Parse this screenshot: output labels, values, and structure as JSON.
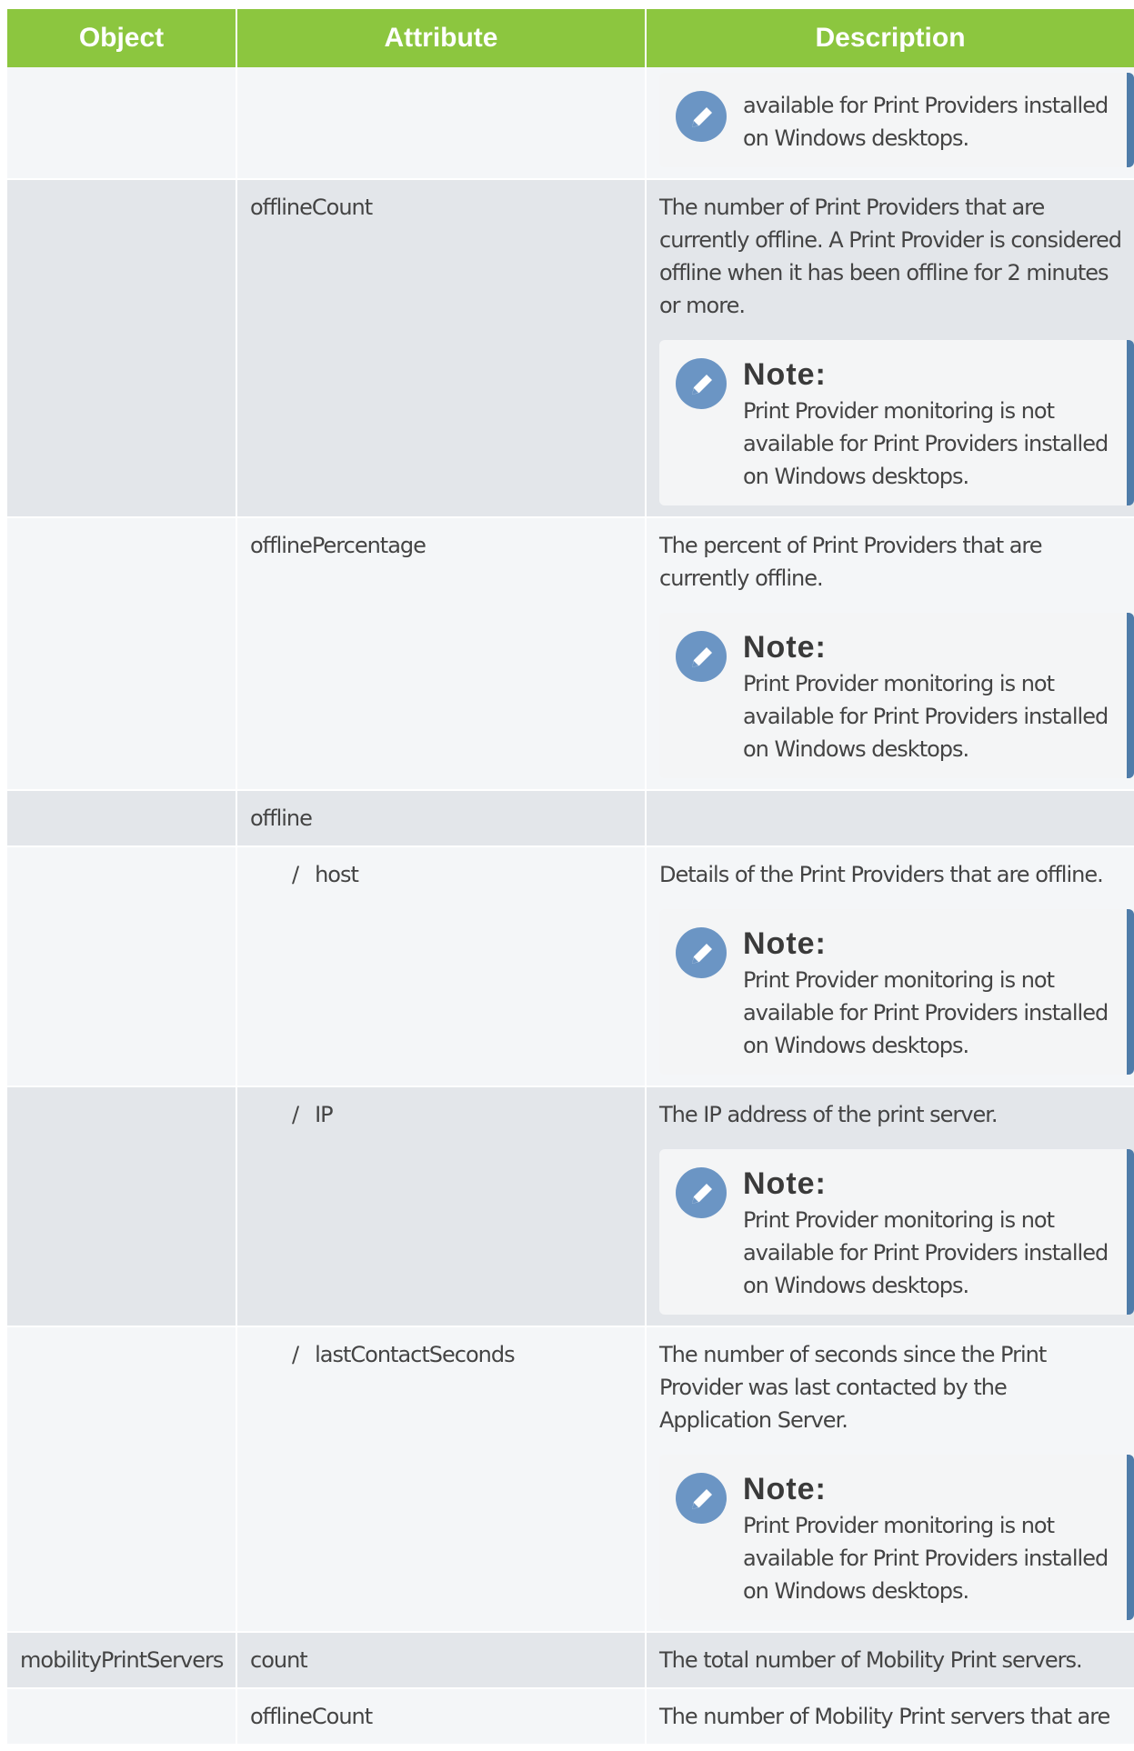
{
  "header": {
    "object": "Object",
    "attribute": "Attribute",
    "description": "Description"
  },
  "rows": [
    {
      "object": "",
      "attribute": "",
      "desc": "",
      "note_title": "",
      "note_body": "available for Print Providers installed on Windows desktops."
    },
    {
      "object": "",
      "attribute": "offlineCount",
      "desc": "The number of Print Providers that are currently offline. A Print Provider is considered offline when it has been offline for 2 minutes or more.",
      "note_title": "Note:",
      "note_body": "Print Provider monitoring is not available for Print Providers installed on Windows desktops."
    },
    {
      "object": "",
      "attribute": "offlinePercentage",
      "desc": "The percent of Print Providers that are currently offline.",
      "note_title": "Note:",
      "note_body": "Print Provider monitoring is not available for Print Providers installed on Windows desktops."
    },
    {
      "object": "",
      "attribute": "offline",
      "desc": ""
    },
    {
      "object": "",
      "attribute": "host",
      "slash": "/",
      "desc": "Details of the Print Providers that are offline.",
      "note_title": "Note:",
      "note_body": "Print Provider monitoring is not available for Print Providers installed on Windows desktops."
    },
    {
      "object": "",
      "attribute": "IP",
      "slash": "/",
      "desc": "The IP address of the print server.",
      "note_title": "Note:",
      "note_body": "Print Provider monitoring is not available for Print Providers installed on Windows desktops."
    },
    {
      "object": "",
      "attribute": "lastContactSeconds",
      "slash": "/",
      "desc": "The number of seconds since the Print Provider was last contacted by the Application Server.",
      "note_title": "Note:",
      "note_body": "Print Provider monitoring is not available for Print Providers installed on Windows desktops."
    },
    {
      "object": "mobilityPrintServers",
      "attribute": "count",
      "desc": "The total number of Mobility Print servers."
    },
    {
      "object": "",
      "attribute": "offlineCount",
      "desc": "The number of Mobility Print servers that are"
    }
  ],
  "icons": {
    "note": "pencil-icon"
  },
  "colors": {
    "header_bg": "#8cc63f",
    "row_light": "#f4f6f8",
    "row_dark": "#e3e6ea",
    "note_accent": "#4f7ca9",
    "icon_bg": "#6b95c4"
  }
}
